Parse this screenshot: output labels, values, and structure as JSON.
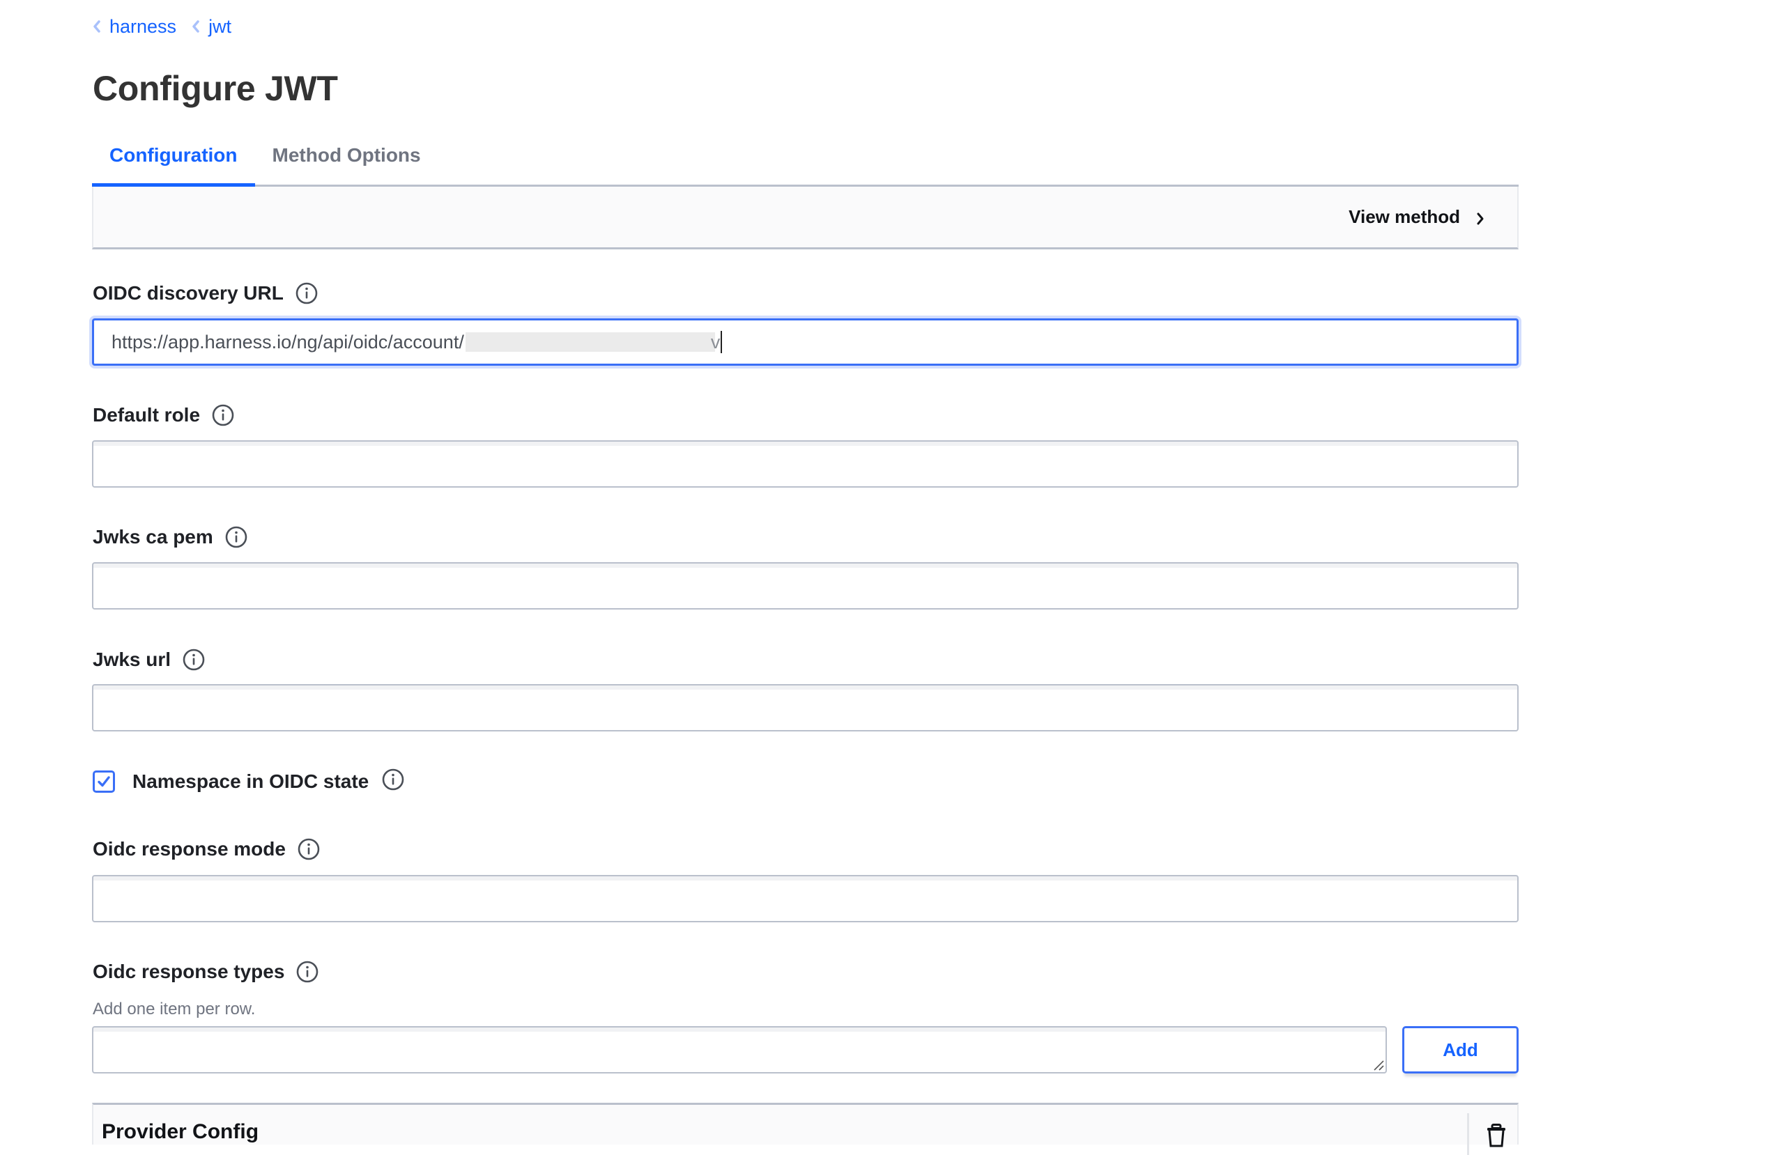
{
  "breadcrumb": [
    {
      "label": "harness",
      "icon": "chevron-left-icon"
    },
    {
      "label": "jwt",
      "icon": "chevron-left-icon"
    }
  ],
  "page": {
    "title": "Configure JWT"
  },
  "tabs": [
    {
      "label": "Configuration",
      "active": true
    },
    {
      "label": "Method Options",
      "active": false
    }
  ],
  "method_panel": {
    "view_method_label": "View method",
    "icon": "chevron-right-icon"
  },
  "fields": {
    "oidc_discovery_url": {
      "label": "OIDC discovery URL",
      "value_visible": "https://app.harness.io/ng/api/oidc/account/",
      "value_redacted": true,
      "value_tail": "v",
      "focused": true
    },
    "default_role": {
      "label": "Default role",
      "value": ""
    },
    "jwks_ca_pem": {
      "label": "Jwks ca pem",
      "value": ""
    },
    "jwks_url": {
      "label": "Jwks url",
      "value": ""
    },
    "namespace_in_oidc_state": {
      "label": "Namespace in OIDC state",
      "checked": true
    },
    "oidc_response_mode": {
      "label": "Oidc response mode",
      "value": ""
    },
    "oidc_response_types": {
      "label": "Oidc response types",
      "help": "Add one item per row.",
      "value": "",
      "add_button": "Add"
    }
  },
  "provider_config": {
    "title": "Provider Config",
    "delete_icon": "trash-icon"
  },
  "colors": {
    "accent": "#1563ff",
    "focus_border": "#3a6ff7",
    "input_border": "#bac0cc",
    "label": "#1f2126",
    "muted": "#6f7480"
  }
}
